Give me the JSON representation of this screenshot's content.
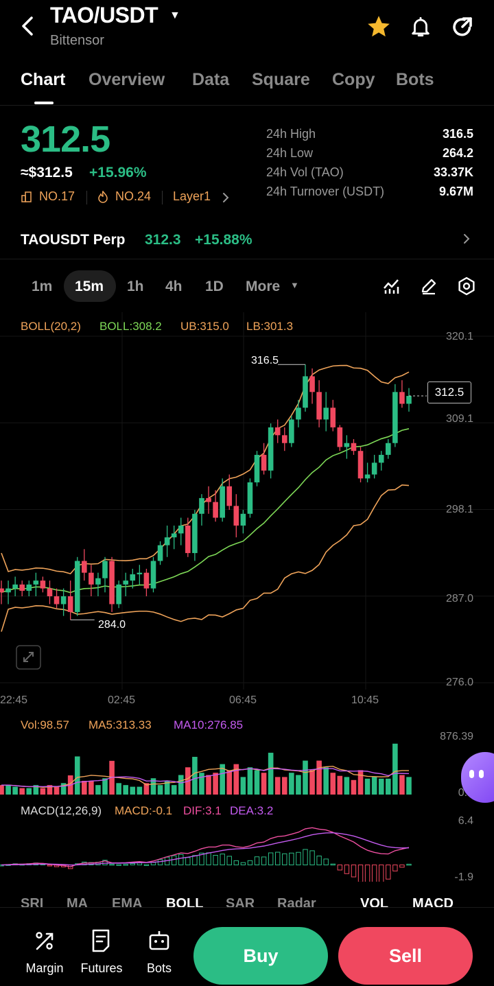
{
  "header": {
    "pair": "TAO/USDT",
    "name": "Bittensor",
    "colors": {
      "green": "#2bbd85",
      "red": "#f0485f",
      "star": "#f5b82e"
    }
  },
  "tabs": [
    "Chart",
    "Overview",
    "Data",
    "Square",
    "Copy",
    "Bots"
  ],
  "price": {
    "last": "312.5",
    "usd": "≈$312.5",
    "change": "+15.96%",
    "rank1": "NO.17",
    "rank2": "NO.24",
    "category": "Layer1"
  },
  "stats": [
    {
      "label": "24h  High",
      "value": "316.5"
    },
    {
      "label": "24h  Low",
      "value": "264.2"
    },
    {
      "label": "24h  Vol (TAO)",
      "value": "33.37K"
    },
    {
      "label": "24h  Turnover (USDT)",
      "value": "9.67M"
    }
  ],
  "perp": {
    "name": "TAOUSDT Perp",
    "price": "312.3",
    "change": "+15.88%"
  },
  "intervals": [
    "1m",
    "15m",
    "1h",
    "4h",
    "1D",
    "More"
  ],
  "boll": {
    "params": "BOLL(20,2)",
    "mid": "BOLL:308.2",
    "ub": "UB:315.0",
    "lb": "LB:301.3"
  },
  "price_axis": [
    "320.1",
    "309.1",
    "298.1",
    "287.0",
    "276.0"
  ],
  "time_axis": [
    "22:45",
    "02:45",
    "06:45",
    "10:45"
  ],
  "chart_marks": {
    "high": "316.5",
    "low": "284.0",
    "current": "312.5"
  },
  "volume": {
    "vol": "Vol:98.57",
    "ma5": "MA5:313.33",
    "ma10": "MA10:276.85",
    "axis_top": "876.39",
    "axis_bottom": "0.0"
  },
  "macd": {
    "params": "MACD(12,26,9)",
    "macd": "MACD:-0.1",
    "dif": "DIF:3.1",
    "dea": "DEA:3.2",
    "axis_top": "6.4",
    "axis_bottom": "-1.9"
  },
  "indicator_tabs": [
    "SRI",
    "MA",
    "EMA",
    "BOLL",
    "SAR",
    "Radar",
    "VOL",
    "MACD"
  ],
  "bottom": {
    "margin": "Margin",
    "futures": "Futures",
    "bots": "Bots",
    "buy": "Buy",
    "sell": "Sell"
  },
  "chart_data": {
    "type": "candlestick",
    "interval": "15m",
    "y_range": [
      276.0,
      320.1
    ],
    "x_labels": [
      "22:45",
      "02:45",
      "06:45",
      "10:45"
    ],
    "candles": [
      [
        288,
        289,
        286,
        287.5
      ],
      [
        287.5,
        289,
        286,
        288
      ],
      [
        288,
        289.5,
        287,
        288.5
      ],
      [
        288.5,
        289,
        287,
        287.7
      ],
      [
        287.7,
        289,
        287,
        288.5
      ],
      [
        288.5,
        290,
        287,
        289
      ],
      [
        289,
        289.5,
        287.5,
        288
      ],
      [
        288,
        289,
        286,
        287
      ],
      [
        287,
        288,
        285.5,
        286
      ],
      [
        286,
        288,
        284.5,
        287
      ],
      [
        287,
        289,
        284,
        285
      ],
      [
        285,
        292,
        284.5,
        291.5
      ],
      [
        291.5,
        293,
        289,
        290
      ],
      [
        290,
        291,
        287,
        288.5
      ],
      [
        288.5,
        290,
        287,
        289.3
      ],
      [
        289.3,
        292,
        287.5,
        291.5
      ],
      [
        291.5,
        292,
        285,
        286
      ],
      [
        286,
        289,
        285.5,
        288.5
      ],
      [
        288.5,
        290,
        287,
        289
      ],
      [
        289,
        290.5,
        288,
        289.8
      ],
      [
        289.8,
        291,
        288.5,
        290
      ],
      [
        290,
        290.5,
        287,
        288
      ],
      [
        288,
        292,
        287.5,
        291.5
      ],
      [
        291.5,
        294,
        291,
        293.5
      ],
      [
        293.5,
        296,
        292,
        294.5
      ],
      [
        294.5,
        296,
        293,
        295
      ],
      [
        295,
        297,
        293.5,
        296
      ],
      [
        296,
        297,
        292,
        292.5
      ],
      [
        292.5,
        298,
        291.5,
        297.5
      ],
      [
        297.5,
        300,
        296,
        299.5
      ],
      [
        299.5,
        301,
        297.5,
        299
      ],
      [
        299,
        300.5,
        296.5,
        297
      ],
      [
        297,
        302,
        296.5,
        301
      ],
      [
        301,
        302.5,
        298,
        298.5
      ],
      [
        298.5,
        300,
        294.5,
        296
      ],
      [
        296,
        298,
        295,
        297.5
      ],
      [
        297.5,
        302,
        297,
        301.5
      ],
      [
        301.5,
        305.5,
        301,
        305
      ],
      [
        305,
        306.5,
        302.5,
        303
      ],
      [
        303,
        309,
        302,
        308.5
      ],
      [
        308.5,
        309.5,
        306.5,
        307.5
      ],
      [
        307.5,
        308.5,
        305.5,
        306.5
      ],
      [
        306.5,
        310,
        306,
        309.5
      ],
      [
        309.5,
        312,
        308.5,
        311
      ],
      [
        311,
        316.5,
        310.5,
        315
      ],
      [
        315,
        316,
        311.5,
        313
      ],
      [
        313,
        314.5,
        308.5,
        309.5
      ],
      [
        309.5,
        313,
        308,
        311
      ],
      [
        311,
        312,
        308,
        308.5
      ],
      [
        308.5,
        308.8,
        305.5,
        306
      ],
      [
        306,
        307.5,
        304.5,
        306.5
      ],
      [
        306.5,
        307,
        305,
        305.5
      ],
      [
        305.5,
        306,
        301.5,
        302
      ],
      [
        302,
        304,
        301.5,
        302.5
      ],
      [
        302.5,
        305,
        302,
        304
      ],
      [
        304,
        305.5,
        303,
        305
      ],
      [
        305,
        307,
        304.5,
        306.5
      ],
      [
        306.5,
        314,
        306,
        313
      ],
      [
        313,
        314.5,
        311,
        311.5
      ],
      [
        311.5,
        313.5,
        310.5,
        312.5
      ]
    ],
    "boll_mid_last": 308.2,
    "boll_ub_last": 315.0,
    "boll_lb_last": 301.3,
    "volume_range": [
      0,
      876.39
    ],
    "macd_range": [
      -1.9,
      6.4
    ]
  }
}
